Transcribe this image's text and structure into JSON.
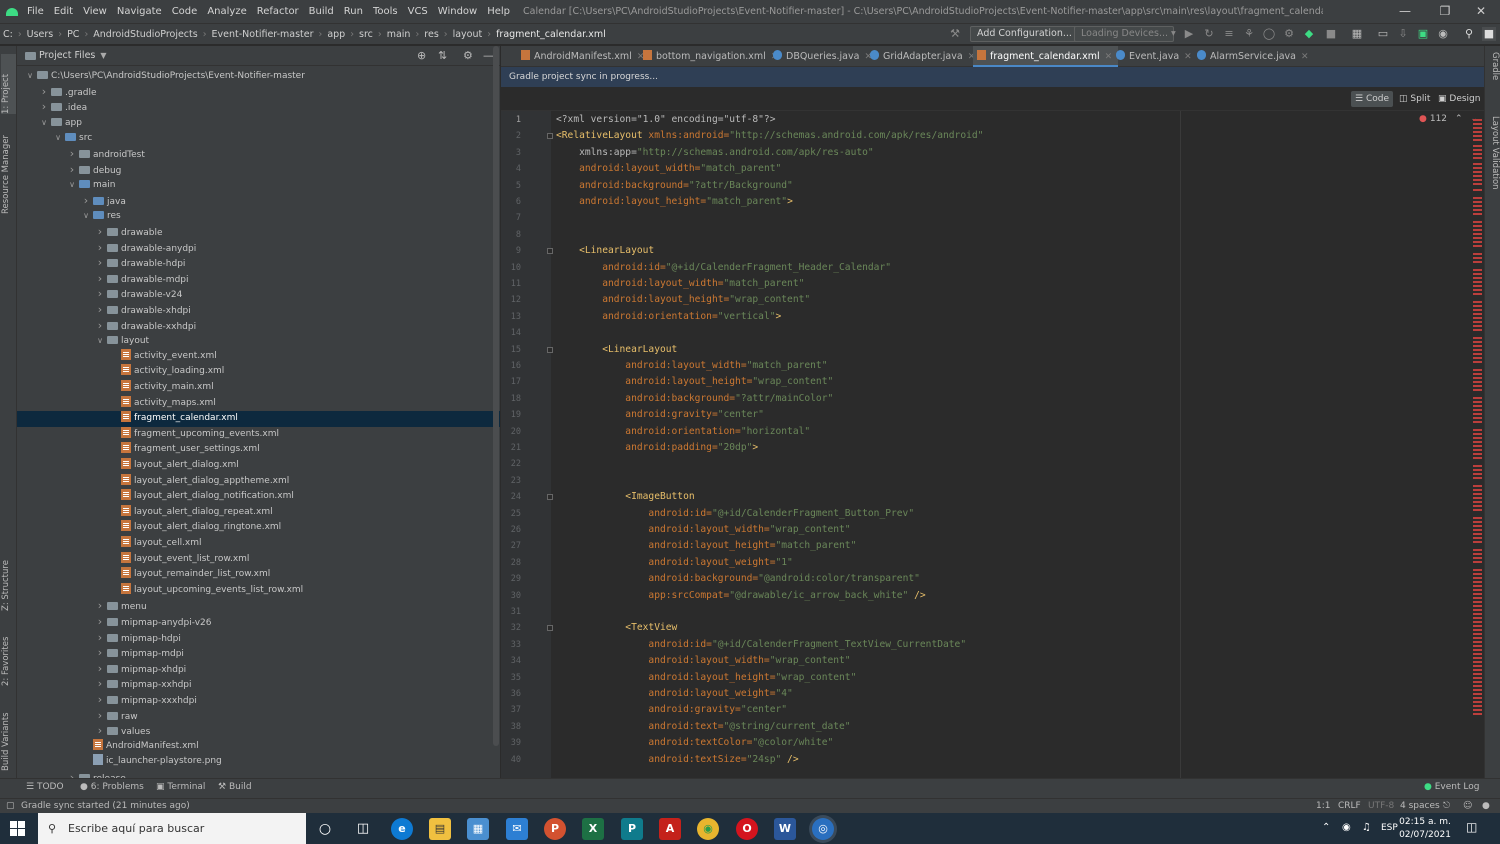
{
  "menubar": {
    "items": [
      "File",
      "Edit",
      "View",
      "Navigate",
      "Code",
      "Analyze",
      "Refactor",
      "Build",
      "Run",
      "Tools",
      "VCS",
      "Window",
      "Help"
    ],
    "title": "Calendar [C:\\Users\\PC\\AndroidStudioProjects\\Event-Notifier-master] - C:\\Users\\PC\\AndroidStudioProjects\\Event-Notifier-master\\app\\src\\main\\res\\layout\\fragment_calendar.xml"
  },
  "breadcrumb": [
    "C:",
    "Users",
    "PC",
    "AndroidStudioProjects",
    "Event-Notifier-master",
    "app",
    "src",
    "main",
    "res",
    "layout",
    "fragment_calendar.xml"
  ],
  "toolbar": {
    "add_config": "Add Configuration...",
    "loading_devices": "Loading Devices..."
  },
  "left_tabs": {
    "project": "1: Project",
    "resource_manager": "Resource Manager",
    "structure": "Z: Structure",
    "favorites": "2: Favorites",
    "build_variants": "Build Variants"
  },
  "right_tabs": {
    "gradle": "Gradle",
    "layout_validation": "Layout Validation"
  },
  "project": {
    "header": "Project Files",
    "tree": [
      {
        "label": "C:\\Users\\PC\\AndroidStudioProjects\\Event-Notifier-master",
        "depth": 0,
        "type": "folder",
        "arrow": "open"
      },
      {
        "label": ".gradle",
        "depth": 1,
        "type": "folder",
        "arrow": "closed"
      },
      {
        "label": ".idea",
        "depth": 1,
        "type": "folder",
        "arrow": "closed"
      },
      {
        "label": "app",
        "depth": 1,
        "type": "folder",
        "arrow": "open"
      },
      {
        "label": "src",
        "depth": 2,
        "type": "folder",
        "arrow": "open"
      },
      {
        "label": "androidTest",
        "depth": 3,
        "type": "folder",
        "arrow": "closed"
      },
      {
        "label": "debug",
        "depth": 3,
        "type": "folder",
        "arrow": "closed"
      },
      {
        "label": "main",
        "depth": 3,
        "type": "folder",
        "arrow": "open"
      },
      {
        "label": "java",
        "depth": 4,
        "type": "folder",
        "arrow": "closed"
      },
      {
        "label": "res",
        "depth": 4,
        "type": "folder",
        "arrow": "open"
      },
      {
        "label": "drawable",
        "depth": 5,
        "type": "folder",
        "arrow": "closed"
      },
      {
        "label": "drawable-anydpi",
        "depth": 5,
        "type": "folder",
        "arrow": "closed"
      },
      {
        "label": "drawable-hdpi",
        "depth": 5,
        "type": "folder",
        "arrow": "closed"
      },
      {
        "label": "drawable-mdpi",
        "depth": 5,
        "type": "folder",
        "arrow": "closed"
      },
      {
        "label": "drawable-v24",
        "depth": 5,
        "type": "folder",
        "arrow": "closed"
      },
      {
        "label": "drawable-xhdpi",
        "depth": 5,
        "type": "folder",
        "arrow": "closed"
      },
      {
        "label": "drawable-xxhdpi",
        "depth": 5,
        "type": "folder",
        "arrow": "closed"
      },
      {
        "label": "layout",
        "depth": 5,
        "type": "folder",
        "arrow": "open"
      },
      {
        "label": "activity_event.xml",
        "depth": 6,
        "type": "xml",
        "arrow": ""
      },
      {
        "label": "activity_loading.xml",
        "depth": 6,
        "type": "xml",
        "arrow": ""
      },
      {
        "label": "activity_main.xml",
        "depth": 6,
        "type": "xml",
        "arrow": ""
      },
      {
        "label": "activity_maps.xml",
        "depth": 6,
        "type": "xml",
        "arrow": ""
      },
      {
        "label": "fragment_calendar.xml",
        "depth": 6,
        "type": "xml",
        "arrow": "",
        "selected": true
      },
      {
        "label": "fragment_upcoming_events.xml",
        "depth": 6,
        "type": "xml",
        "arrow": ""
      },
      {
        "label": "fragment_user_settings.xml",
        "depth": 6,
        "type": "xml",
        "arrow": ""
      },
      {
        "label": "layout_alert_dialog.xml",
        "depth": 6,
        "type": "xml",
        "arrow": ""
      },
      {
        "label": "layout_alert_dialog_apptheme.xml",
        "depth": 6,
        "type": "xml",
        "arrow": ""
      },
      {
        "label": "layout_alert_dialog_notification.xml",
        "depth": 6,
        "type": "xml",
        "arrow": ""
      },
      {
        "label": "layout_alert_dialog_repeat.xml",
        "depth": 6,
        "type": "xml",
        "arrow": ""
      },
      {
        "label": "layout_alert_dialog_ringtone.xml",
        "depth": 6,
        "type": "xml",
        "arrow": ""
      },
      {
        "label": "layout_cell.xml",
        "depth": 6,
        "type": "xml",
        "arrow": ""
      },
      {
        "label": "layout_event_list_row.xml",
        "depth": 6,
        "type": "xml",
        "arrow": ""
      },
      {
        "label": "layout_remainder_list_row.xml",
        "depth": 6,
        "type": "xml",
        "arrow": ""
      },
      {
        "label": "layout_upcoming_events_list_row.xml",
        "depth": 6,
        "type": "xml",
        "arrow": ""
      },
      {
        "label": "menu",
        "depth": 5,
        "type": "folder",
        "arrow": "closed"
      },
      {
        "label": "mipmap-anydpi-v26",
        "depth": 5,
        "type": "folder",
        "arrow": "closed"
      },
      {
        "label": "mipmap-hdpi",
        "depth": 5,
        "type": "folder",
        "arrow": "closed"
      },
      {
        "label": "mipmap-mdpi",
        "depth": 5,
        "type": "folder",
        "arrow": "closed"
      },
      {
        "label": "mipmap-xhdpi",
        "depth": 5,
        "type": "folder",
        "arrow": "closed"
      },
      {
        "label": "mipmap-xxhdpi",
        "depth": 5,
        "type": "folder",
        "arrow": "closed"
      },
      {
        "label": "mipmap-xxxhdpi",
        "depth": 5,
        "type": "folder",
        "arrow": "closed"
      },
      {
        "label": "raw",
        "depth": 5,
        "type": "folder",
        "arrow": "closed"
      },
      {
        "label": "values",
        "depth": 5,
        "type": "folder",
        "arrow": "closed"
      },
      {
        "label": "AndroidManifest.xml",
        "depth": 4,
        "type": "xml",
        "arrow": ""
      },
      {
        "label": "ic_launcher-playstore.png",
        "depth": 4,
        "type": "png",
        "arrow": ""
      },
      {
        "label": "release",
        "depth": 3,
        "type": "folder",
        "arrow": "closed"
      }
    ]
  },
  "editor": {
    "tabs": [
      {
        "label": "AndroidManifest.xml",
        "kind": "xml"
      },
      {
        "label": "bottom_navigation.xml",
        "kind": "xml"
      },
      {
        "label": "DBQueries.java",
        "kind": "java"
      },
      {
        "label": "GridAdapter.java",
        "kind": "java"
      },
      {
        "label": "fragment_calendar.xml",
        "kind": "xml",
        "active": true
      },
      {
        "label": "Event.java",
        "kind": "java"
      },
      {
        "label": "AlarmService.java",
        "kind": "java"
      }
    ],
    "sync_message": "Gradle project sync in progress...",
    "modes": {
      "code": "Code",
      "split": "Split",
      "design": "Design"
    },
    "error_count": "112",
    "lines": [
      {
        "n": "1",
        "parts": [
          [
            "plain",
            "<?xml version=\"1.0\" encoding=\"utf-8\"?>"
          ]
        ]
      },
      {
        "n": "2",
        "parts": [
          [
            "tag",
            "<RelativeLayout "
          ],
          [
            "attr",
            "xmlns:android="
          ],
          [
            "str",
            "\"http://schemas.android.com/apk/res/android\""
          ]
        ]
      },
      {
        "n": "3",
        "parts": [
          [
            "plain",
            "    xmlns:app="
          ],
          [
            "str",
            "\"http://schemas.android.com/apk/res-auto\""
          ]
        ]
      },
      {
        "n": "4",
        "parts": [
          [
            "attr",
            "    android:layout_width="
          ],
          [
            "str",
            "\"match_parent\""
          ]
        ]
      },
      {
        "n": "5",
        "parts": [
          [
            "attr",
            "    android:background="
          ],
          [
            "str",
            "\"?attr/Background\""
          ]
        ]
      },
      {
        "n": "6",
        "parts": [
          [
            "attr",
            "    android:layout_height="
          ],
          [
            "str",
            "\"match_parent\""
          ],
          [
            "tag",
            ">"
          ]
        ]
      },
      {
        "n": "7",
        "parts": []
      },
      {
        "n": "8",
        "parts": []
      },
      {
        "n": "9",
        "parts": [
          [
            "tag",
            "    <LinearLayout"
          ]
        ]
      },
      {
        "n": "10",
        "parts": [
          [
            "attr",
            "        android:id="
          ],
          [
            "str",
            "\"@+id/CalenderFragment_Header_Calendar\""
          ]
        ]
      },
      {
        "n": "11",
        "parts": [
          [
            "attr",
            "        android:layout_width="
          ],
          [
            "str",
            "\"match_parent\""
          ]
        ]
      },
      {
        "n": "12",
        "parts": [
          [
            "attr",
            "        android:layout_height="
          ],
          [
            "str",
            "\"wrap_content\""
          ]
        ]
      },
      {
        "n": "13",
        "parts": [
          [
            "attr",
            "        android:orientation="
          ],
          [
            "str",
            "\"vertical\""
          ],
          [
            "tag",
            ">"
          ]
        ]
      },
      {
        "n": "14",
        "parts": []
      },
      {
        "n": "15",
        "parts": [
          [
            "tag",
            "        <LinearLayout"
          ]
        ]
      },
      {
        "n": "16",
        "parts": [
          [
            "attr",
            "            android:layout_width="
          ],
          [
            "str",
            "\"match_parent\""
          ]
        ]
      },
      {
        "n": "17",
        "parts": [
          [
            "attr",
            "            android:layout_height="
          ],
          [
            "str",
            "\"wrap_content\""
          ]
        ]
      },
      {
        "n": "18",
        "parts": [
          [
            "attr",
            "            android:background="
          ],
          [
            "str",
            "\"?attr/mainColor\""
          ]
        ]
      },
      {
        "n": "19",
        "parts": [
          [
            "attr",
            "            android:gravity="
          ],
          [
            "str",
            "\"center\""
          ]
        ]
      },
      {
        "n": "20",
        "parts": [
          [
            "attr",
            "            android:orientation="
          ],
          [
            "str",
            "\"horizontal\""
          ]
        ]
      },
      {
        "n": "21",
        "parts": [
          [
            "attr",
            "            android:padding="
          ],
          [
            "str",
            "\"20dp\""
          ],
          [
            "tag",
            ">"
          ]
        ]
      },
      {
        "n": "22",
        "parts": []
      },
      {
        "n": "23",
        "parts": []
      },
      {
        "n": "24",
        "parts": [
          [
            "tag",
            "            <ImageButton"
          ]
        ]
      },
      {
        "n": "25",
        "parts": [
          [
            "attr",
            "                android:id="
          ],
          [
            "str",
            "\"@+id/CalenderFragment_Button_Prev\""
          ]
        ]
      },
      {
        "n": "26",
        "parts": [
          [
            "attr",
            "                android:layout_width="
          ],
          [
            "str",
            "\"wrap_content\""
          ]
        ]
      },
      {
        "n": "27",
        "parts": [
          [
            "attr",
            "                android:layout_height="
          ],
          [
            "str",
            "\"match_parent\""
          ]
        ]
      },
      {
        "n": "28",
        "parts": [
          [
            "attr",
            "                android:layout_weight="
          ],
          [
            "str",
            "\"1\""
          ]
        ]
      },
      {
        "n": "29",
        "parts": [
          [
            "attr",
            "                android:background="
          ],
          [
            "str",
            "\"@android:color/transparent\""
          ]
        ]
      },
      {
        "n": "30",
        "parts": [
          [
            "attr",
            "                app:srcCompat="
          ],
          [
            "str",
            "\"@drawable/ic_arrow_back_white\""
          ],
          [
            "tag",
            " />"
          ]
        ]
      },
      {
        "n": "31",
        "parts": []
      },
      {
        "n": "32",
        "parts": [
          [
            "tag",
            "            <TextView"
          ]
        ]
      },
      {
        "n": "33",
        "parts": [
          [
            "attr",
            "                android:id="
          ],
          [
            "str",
            "\"@+id/CalenderFragment_TextView_CurrentDate\""
          ]
        ]
      },
      {
        "n": "34",
        "parts": [
          [
            "attr",
            "                android:layout_width="
          ],
          [
            "str",
            "\"wrap_content\""
          ]
        ]
      },
      {
        "n": "35",
        "parts": [
          [
            "attr",
            "                android:layout_height="
          ],
          [
            "str",
            "\"wrap_content\""
          ]
        ]
      },
      {
        "n": "36",
        "parts": [
          [
            "attr",
            "                android:layout_weight="
          ],
          [
            "str",
            "\"4\""
          ]
        ]
      },
      {
        "n": "37",
        "parts": [
          [
            "attr",
            "                android:gravity="
          ],
          [
            "str",
            "\"center\""
          ]
        ]
      },
      {
        "n": "38",
        "parts": [
          [
            "attr",
            "                android:text="
          ],
          [
            "str",
            "\"@string/current_date\""
          ]
        ]
      },
      {
        "n": "39",
        "parts": [
          [
            "attr",
            "                android:textColor="
          ],
          [
            "str",
            "\"@color/white\""
          ]
        ]
      },
      {
        "n": "40",
        "parts": [
          [
            "attr",
            "                android:textSize="
          ],
          [
            "str",
            "\"24sp\""
          ],
          [
            "tag",
            " />"
          ]
        ]
      }
    ]
  },
  "bottom_tabs": {
    "todo": "TODO",
    "problems": "6: Problems",
    "terminal": "Terminal",
    "build": "Build",
    "event_log": "Event Log"
  },
  "status": {
    "message": "Gradle sync started (21 minutes ago)",
    "position": "1:1",
    "line_sep": "CRLF",
    "encoding": "UTF-8",
    "indent": "4 spaces"
  },
  "taskbar": {
    "search_placeholder": "Escribe aquí para buscar",
    "lang": "ESP",
    "time": "02:15 a. m.",
    "date": "02/07/2021"
  },
  "colors": {
    "accent": "#4a88c7",
    "selection": "#0d293e",
    "error": "#bc3f3c",
    "tag": "#e8bf6a",
    "attribute": "#cc7832",
    "string": "#6a8759"
  }
}
